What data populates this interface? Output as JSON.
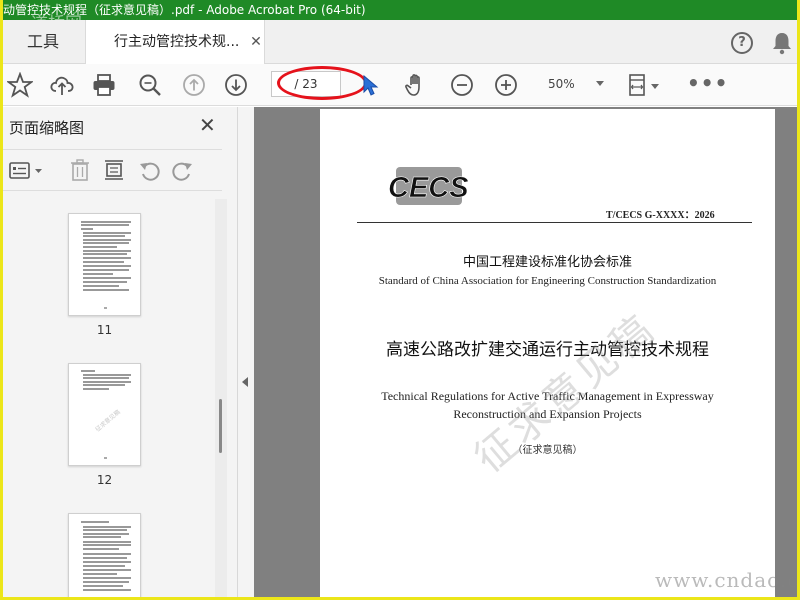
{
  "window": {
    "title": "动管控技术规程（征求意见稿）.pdf - Adobe Acrobat Pro (64-bit)",
    "watermark_top": "道桥网"
  },
  "tabs": {
    "tools_label": "工具",
    "doc_label": "行主动管控技术规...",
    "close_glyph": "✕"
  },
  "header_icons": {
    "help": "?",
    "help_icon": "help-icon",
    "bell_icon": "bell-icon"
  },
  "toolbar": {
    "page_indicator": "/ 23",
    "zoom_value": "50%",
    "more_glyph": "•••",
    "icons": [
      "star-icon",
      "cloud-upload-icon",
      "print-icon",
      "zoom-search-icon",
      "previous-page-icon",
      "next-page-icon",
      "cursor-icon",
      "hand-icon",
      "zoom-out-icon",
      "zoom-in-icon",
      "fit-page-icon"
    ]
  },
  "sidebar": {
    "title": "页面缩略图",
    "close_glyph": "✕",
    "thumbnails": [
      {
        "label": "11"
      },
      {
        "label": "12"
      },
      {
        "label": ""
      }
    ]
  },
  "document": {
    "logo_text": "CECS",
    "std_code": "T/CECS G-XXXX：2026",
    "cn_assoc": "中国工程建设标准化协会标准",
    "en_assoc": "Standard of China Association for Engineering Construction Standardization",
    "cn_title": "高速公路改扩建交通运行主动管控技术规程",
    "en_title": "Technical Regulations for Active Traffic Management in Expressway Reconstruction and Expansion Projects",
    "draft": "（征求意见稿）",
    "diagonal_watermark": "征求意见稿"
  },
  "site_watermark": "www.cndao.co",
  "colors": {
    "titlebar": "#1f8a26",
    "frame_border": "#ece619",
    "annotation_oval": "#e5121b",
    "doc_background": "#808080"
  }
}
